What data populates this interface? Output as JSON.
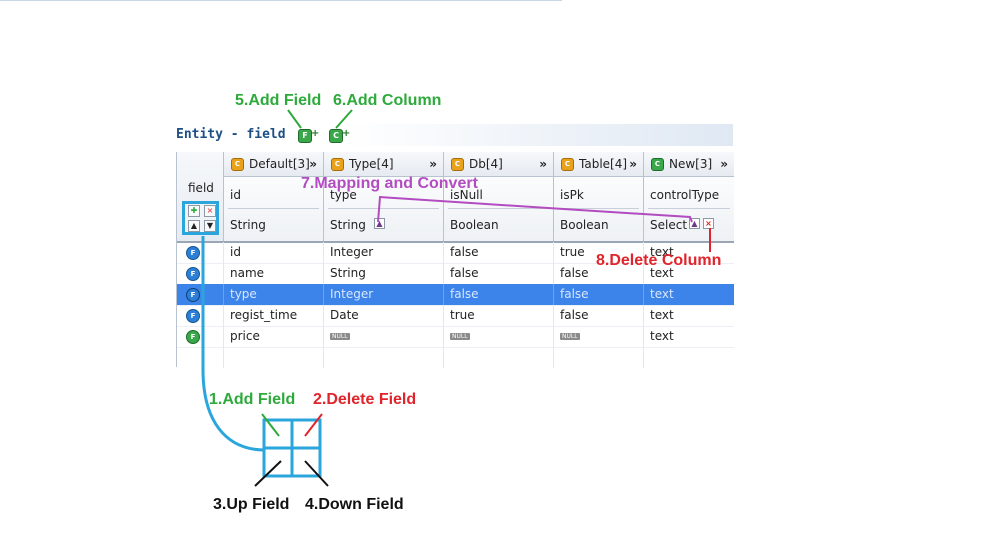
{
  "annotations": {
    "add_field": "5.Add Field",
    "add_column": "6.Add Column",
    "mapping": "7.Mapping and Convert",
    "delete_column": "8.Delete Column",
    "field_add": "1.Add Field",
    "field_delete": "2.Delete Field",
    "field_up": "3.Up Field",
    "field_down": "4.Down Field"
  },
  "entity": {
    "title": "Entity - field",
    "add_field_icon": "F",
    "add_column_icon": "C"
  },
  "field_header": "field",
  "groups": [
    {
      "label": "Default[3]",
      "icon": "C",
      "color": "#e9a21c",
      "arrows": "»"
    },
    {
      "label": "Type[4]",
      "icon": "C",
      "color": "#e9a21c",
      "arrows": "»"
    },
    {
      "label": "Db[4]",
      "icon": "C",
      "color": "#e9a21c",
      "arrows": "»"
    },
    {
      "label": "Table[4]",
      "icon": "C",
      "color": "#e9a21c",
      "arrows": "»"
    },
    {
      "label": "New[3]",
      "icon": "C",
      "color": "#38a84a",
      "arrows": "»"
    }
  ],
  "subcols": [
    {
      "name": "id",
      "type": "String"
    },
    {
      "name": "type",
      "type": "String"
    },
    {
      "name": "isNull",
      "type": "Boolean"
    },
    {
      "name": "isPk",
      "type": "Boolean"
    },
    {
      "name": "controlType",
      "type": "Select"
    }
  ],
  "null_label": "NULL",
  "rows": [
    {
      "icon_color": "#2b7fd6",
      "id": "id",
      "type": "Integer",
      "isNull": "false",
      "isPk": "true",
      "controlType": "text"
    },
    {
      "icon_color": "#2b7fd6",
      "id": "name",
      "type": "String",
      "isNull": "false",
      "isPk": "false",
      "controlType": "text"
    },
    {
      "icon_color": "#2b7fd6",
      "id": "type",
      "type": "Integer",
      "isNull": "false",
      "isPk": "false",
      "controlType": "text",
      "selected": true
    },
    {
      "icon_color": "#2b7fd6",
      "id": "regist_time",
      "type": "Date",
      "isNull": "true",
      "isPk": "false",
      "controlType": "text"
    },
    {
      "icon_color": "#38a84a",
      "id": "price",
      "type": "NULL",
      "isNull": "NULL",
      "isPk": "NULL",
      "controlType": "text"
    }
  ],
  "colors": {
    "green": "#2eaa3c",
    "red": "#e0242b",
    "purple": "#b24cc0",
    "blue": "#2aa6dc",
    "selection": "#3d84ea"
  },
  "icons": {
    "add": "plus-icon",
    "delete": "x-icon",
    "up": "up-arrow-icon",
    "down": "down-arrow-icon",
    "mapping": "triangle-icon",
    "field_type": "f-circle-icon"
  }
}
